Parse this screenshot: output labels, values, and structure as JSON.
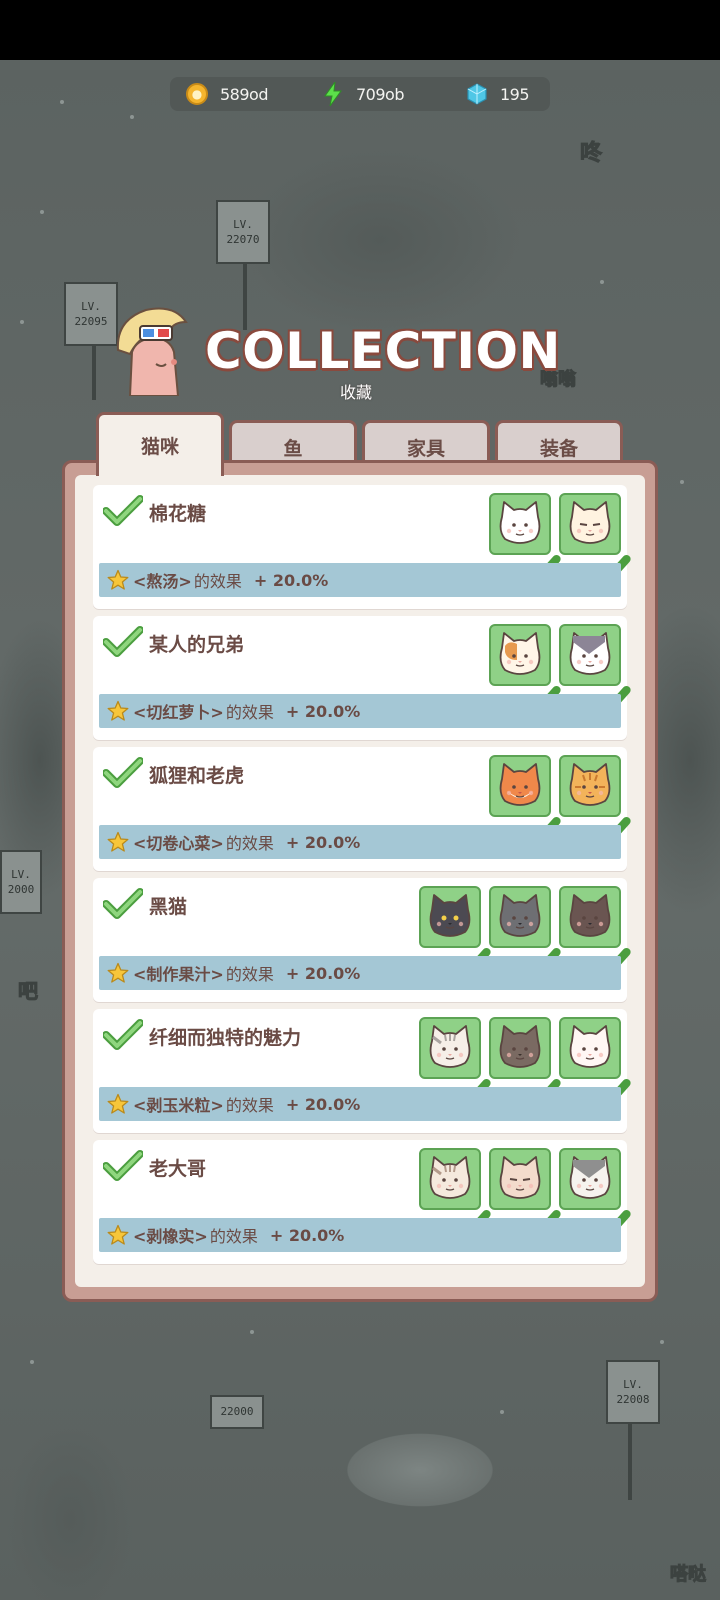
{
  "currencies": {
    "coins": "589od",
    "energy": "709ob",
    "gems": "195"
  },
  "header": {
    "title": "COLLECTION",
    "subtitle": "收藏"
  },
  "tabs": [
    {
      "label": "猫咪",
      "active": true
    },
    {
      "label": "鱼",
      "active": false
    },
    {
      "label": "家具",
      "active": false
    },
    {
      "label": "装备",
      "active": false
    }
  ],
  "background": {
    "signs": [
      {
        "lv": "LV.",
        "num": "22070"
      },
      {
        "lv": "LV.",
        "num": "22095"
      },
      {
        "lv": "LV.",
        "num": "22000"
      },
      {
        "lv": "LV.",
        "num": "22008"
      }
    ],
    "sign_small_2000": "2000",
    "sign_pad_22000": "22000",
    "bubble_dong": "咚",
    "bubble_weng": "嗡嗡",
    "bubble_ba": "吧",
    "bubble_da": "嗒哒"
  },
  "collections": [
    {
      "name": "棉花糖",
      "task": "<熬汤>",
      "effect": "的效果",
      "bonus": "+ 20.0%",
      "cats": [
        {
          "fur": "#ffffff",
          "accent": "#f0e7dc",
          "nose": "#e8a8a0",
          "face": "happy"
        },
        {
          "fur": "#fff3e0",
          "accent": "#f2d9b5",
          "nose": "#e8a8a0",
          "face": "grumpy"
        }
      ]
    },
    {
      "name": "某人的兄弟",
      "task": "<切红萝卜>",
      "effect": "的效果",
      "bonus": "+ 20.0%",
      "cats": [
        {
          "fur": "#fff6e8",
          "accent": "#e79a4f",
          "nose": "#e8a8a0",
          "face": "calico"
        },
        {
          "fur": "#ffffff",
          "accent": "#8c8596",
          "nose": "#e8a8a0",
          "face": "tux"
        }
      ]
    },
    {
      "name": "狐狸和老虎",
      "task": "<切卷心菜>",
      "effect": "的效果",
      "bonus": "+ 20.0%",
      "cats": [
        {
          "fur": "#f0884a",
          "accent": "#fff4e8",
          "nose": "#c8574a",
          "face": "fox"
        },
        {
          "fur": "#f3b35a",
          "accent": "#c9792f",
          "nose": "#c8574a",
          "face": "tiger"
        }
      ]
    },
    {
      "name": "黑猫",
      "task": "<制作果汁>",
      "effect": "的效果",
      "bonus": "+ 20.0%",
      "cats": [
        {
          "fur": "#4c4a52",
          "accent": "#4c4a52",
          "nose": "#2b2a2f",
          "face": "black"
        },
        {
          "fur": "#6e6f73",
          "accent": "#55565a",
          "nose": "#2b2a2f",
          "face": "grey"
        },
        {
          "fur": "#6a5551",
          "accent": "#5a4642",
          "nose": "#2b2a2f",
          "face": "brown"
        }
      ]
    },
    {
      "name": "纤细而独特的魅力",
      "task": "<剥玉米粒>",
      "effect": "的效果",
      "bonus": "+ 20.0%",
      "cats": [
        {
          "fur": "#f6efe8",
          "accent": "#a9a39f",
          "nose": "#e8a8a0",
          "face": "tabby"
        },
        {
          "fur": "#7a6a62",
          "accent": "#5f514b",
          "nose": "#3a302c",
          "face": "brown"
        },
        {
          "fur": "#fff7f4",
          "accent": "#f0d3cc",
          "nose": "#e8a8a0",
          "face": "happy"
        }
      ]
    },
    {
      "name": "老大哥",
      "task": "<剥橡实>",
      "effect": "的效果",
      "bonus": "+ 20.0%",
      "cats": [
        {
          "fur": "#f5e9dd",
          "accent": "#b39a8a",
          "nose": "#e8a8a0",
          "face": "tabby"
        },
        {
          "fur": "#f3dbcc",
          "accent": "#b98a74",
          "nose": "#e8a8a0",
          "face": "grumpy"
        },
        {
          "fur": "#f6f3ee",
          "accent": "#8f8f8f",
          "nose": "#e8a8a0",
          "face": "tux"
        }
      ]
    }
  ]
}
